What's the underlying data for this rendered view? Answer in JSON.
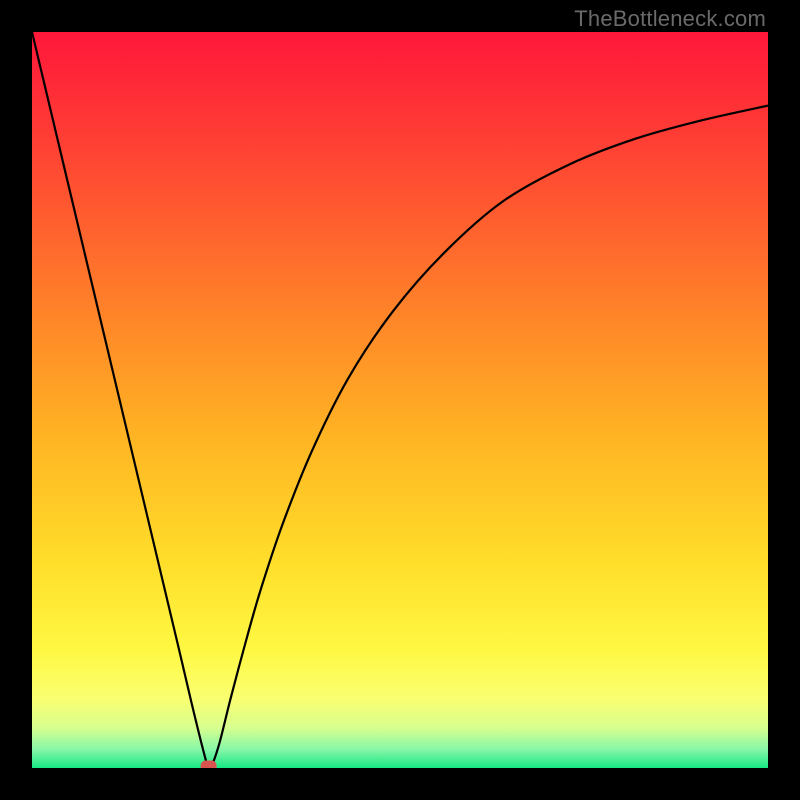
{
  "watermark": "TheBottleneck.com",
  "chart_data": {
    "type": "line",
    "title": "",
    "xlabel": "",
    "ylabel": "",
    "xlim": [
      0,
      100
    ],
    "ylim": [
      0,
      100
    ],
    "grid": false,
    "legend": false,
    "series": [
      {
        "name": "bottleneck-curve",
        "x": [
          0,
          5,
          10,
          15,
          20,
          22,
          23.5,
          24,
          24.5,
          25.5,
          27,
          29,
          31,
          34,
          38,
          43,
          49,
          56,
          64,
          73,
          82,
          91,
          100
        ],
        "y": [
          100,
          79,
          58,
          37,
          16,
          7.5,
          1.5,
          0,
          0.5,
          3.5,
          9.5,
          17,
          24,
          33,
          43,
          53,
          62,
          70,
          77,
          82,
          85.5,
          88,
          90
        ]
      }
    ],
    "marker": {
      "name": "optimal-point",
      "x": 24,
      "y": 0,
      "color": "#d9534f",
      "shape": "rounded-rect"
    },
    "background_gradient": {
      "direction": "vertical",
      "stops": [
        {
          "offset": 0.0,
          "color": "#ff173a"
        },
        {
          "offset": 0.15,
          "color": "#ff3f34"
        },
        {
          "offset": 0.35,
          "color": "#ff7a2a"
        },
        {
          "offset": 0.55,
          "color": "#ffb423"
        },
        {
          "offset": 0.72,
          "color": "#ffde2a"
        },
        {
          "offset": 0.84,
          "color": "#fff843"
        },
        {
          "offset": 0.905,
          "color": "#faff70"
        },
        {
          "offset": 0.945,
          "color": "#d8ff8e"
        },
        {
          "offset": 0.975,
          "color": "#86f7a8"
        },
        {
          "offset": 1.0,
          "color": "#17e884"
        }
      ]
    }
  }
}
